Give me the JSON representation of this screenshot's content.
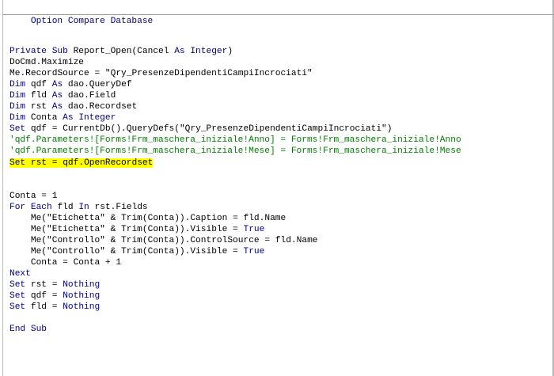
{
  "editor": {
    "header_line": "Option Compare Database",
    "lines": [
      "",
      "Private Sub Report_Open(Cancel As Integer)",
      "DoCmd.Maximize",
      "Me.RecordSource = \"Qry_PresenzeDipendentiCampiIncrociati\"",
      "Dim qdf As dao.QueryDef",
      "Dim fld As dao.Field",
      "Dim rst As dao.Recordset",
      "Dim Conta As Integer",
      "Set qdf = CurrentDb().QueryDefs(\"Qry_PresenzeDipendentiCampiIncrociati\")",
      "'qdf.Parameters![Forms!Frm_maschera_iniziale!Anno] = Forms!Frm_maschera_iniziale!Anno",
      "'qdf.Parameters![Forms!Frm_maschera_iniziale!Mese] = Forms!Frm_maschera_iniziale!Mese",
      "Set rst = qdf.OpenRecordset",
      "",
      "",
      "Conta = 1",
      "For Each fld In rst.Fields",
      "    Me(\"Etichetta\" & Trim(Conta)).Caption = fld.Name",
      "    Me(\"Etichetta\" & Trim(Conta)).Visible = True",
      "    Me(\"Controllo\" & Trim(Conta)).ControlSource = fld.Name",
      "    Me(\"Controllo\" & Trim(Conta)).Visible = True",
      "    Conta = Conta + 1",
      "Next",
      "Set rst = Nothing",
      "Set qdf = Nothing",
      "Set fld = Nothing",
      "",
      "End Sub"
    ],
    "highlighted_line_index": 11,
    "colors": {
      "keyword": "#00008b",
      "comment": "#008000",
      "plain": "#000000",
      "highlight": "#ffff00"
    },
    "keywords": [
      "Option",
      "Compare",
      "Database",
      "Private",
      "Sub",
      "As",
      "Integer",
      "Dim",
      "Set",
      "For",
      "Each",
      "In",
      "Next",
      "Nothing",
      "True",
      "End"
    ]
  }
}
